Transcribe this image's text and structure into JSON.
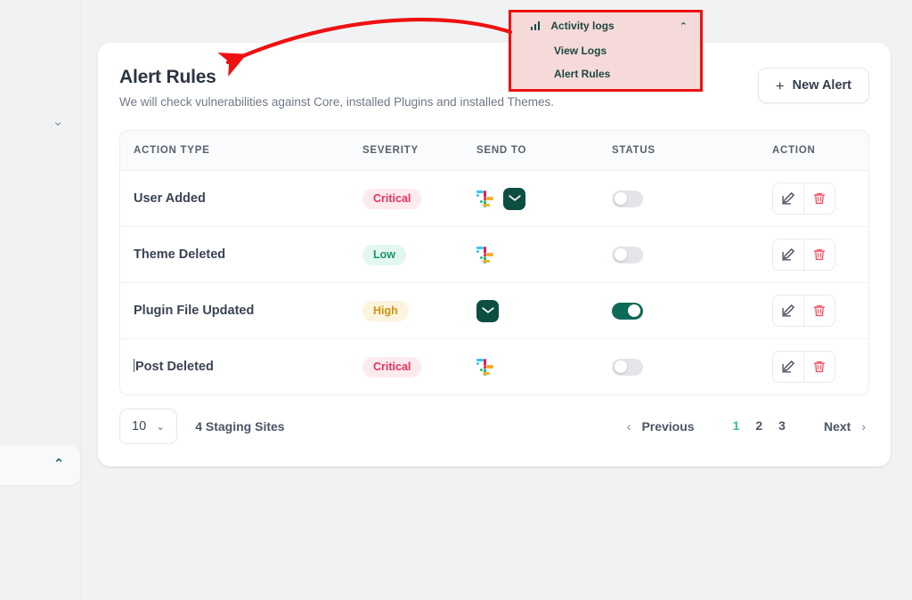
{
  "card": {
    "title": "Alert Rules",
    "subtitle": "We will check vulnerabilities against Core, installed Plugins and installed Themes.",
    "new_alert_label": "New Alert",
    "new_alert_plus": "+"
  },
  "table": {
    "headers": [
      "ACTION TYPE",
      "SEVERITY",
      "SEND TO",
      "STATUS",
      "ACTION"
    ],
    "rows": [
      {
        "action_type": "User Added",
        "severity": "Critical",
        "severity_class": "critical",
        "send_to": [
          "slack-icon",
          "email-icon"
        ],
        "status_on": false,
        "caret": false
      },
      {
        "action_type": "Theme Deleted",
        "severity": "Low",
        "severity_class": "low",
        "send_to": [
          "slack-icon"
        ],
        "status_on": false,
        "caret": false
      },
      {
        "action_type": "Plugin File Updated",
        "severity": "High",
        "severity_class": "high",
        "send_to": [
          "email-icon"
        ],
        "status_on": true,
        "caret": false
      },
      {
        "action_type": "Post Deleted",
        "severity": "Critical",
        "severity_class": "critical",
        "send_to": [
          "slack-icon"
        ],
        "status_on": false,
        "caret": true
      }
    ]
  },
  "footer": {
    "per_page_value": "10",
    "per_page_chevron": "⌄",
    "staging_count": "4 Staging Sites",
    "previous_label": "Previous",
    "next_label": "Next",
    "prev_arrow": "‹",
    "next_arrow": "›",
    "pages": [
      "1",
      "2",
      "3"
    ],
    "active_page": "1"
  },
  "activity_menu": {
    "title": "Activity logs",
    "chevron": "⌃",
    "items": [
      "View Logs",
      "Alert Rules"
    ]
  },
  "left_rail": {
    "chevron_down": "⌄",
    "chevron_up": "⌃"
  },
  "colors": {
    "accent_teal": "#0d6b57",
    "critical_bg": "#fdeaef",
    "critical_fg": "#e0345a",
    "low_bg": "#e2f7ef",
    "low_fg": "#1f8f72",
    "high_bg": "#fdf4dd",
    "high_fg": "#cf9316",
    "active_page": "#2fbf8f",
    "annotation_red": "#ee1111",
    "menu_bg": "#f6dada"
  }
}
